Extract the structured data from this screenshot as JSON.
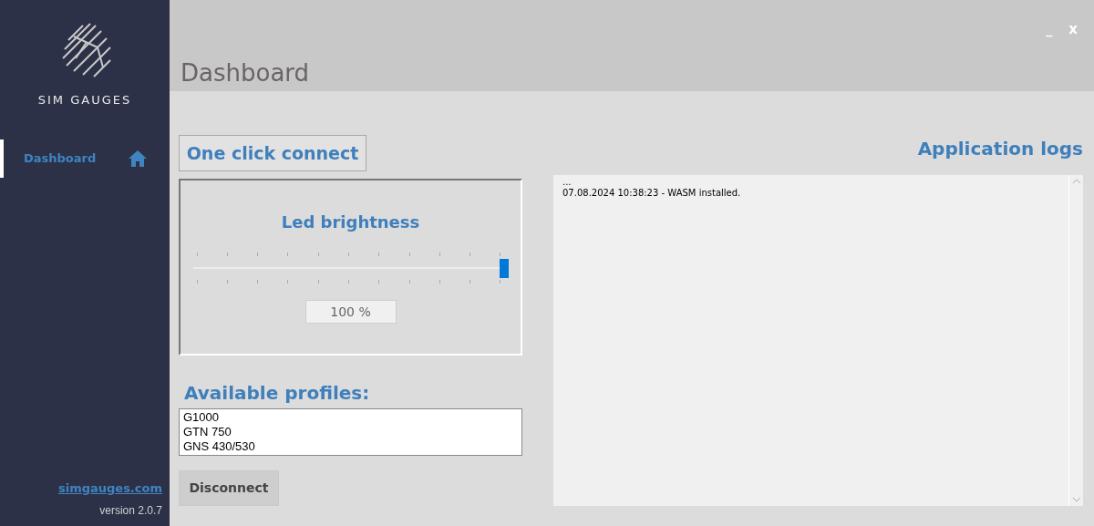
{
  "window": {
    "minimize": "_",
    "close": "x"
  },
  "sidebar": {
    "brand": "SIM GAUGES",
    "items": [
      {
        "label": "Dashboard",
        "selected": true
      }
    ],
    "link": "simgauges.com",
    "version": "version 2.0.7"
  },
  "page_title": "Dashboard",
  "connect_button": "One click connect",
  "brightness": {
    "title": "Led brightness",
    "level": 1,
    "reading": "100 %"
  },
  "profiles": {
    "title": "Available profiles:",
    "items": [
      "G1000",
      "GTN 750",
      "GNS 430/530"
    ]
  },
  "disconnect_button": "Disconnect",
  "logs": {
    "title": "Application logs",
    "lines": [
      "...",
      "07.08.2024 10:38:23 - WASM installed."
    ]
  }
}
